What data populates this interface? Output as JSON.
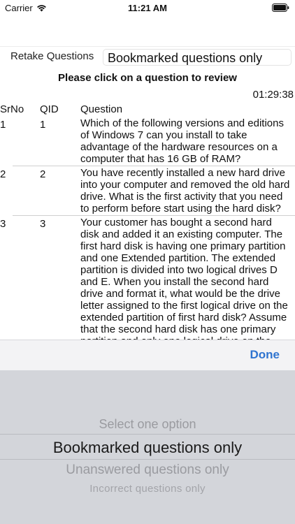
{
  "status_bar": {
    "carrier": "Carrier",
    "time": "11:21 AM"
  },
  "retake": {
    "label": "Retake Questions",
    "selected_filter": "Bookmarked questions only"
  },
  "instruction": "Please click on a question to review",
  "timer": "01:29:38",
  "table": {
    "headers": {
      "srno": "SrNo",
      "qid": "QID",
      "question": "Question"
    },
    "rows": [
      {
        "srno": "1",
        "qid": "1",
        "question": "Which of the following versions and editions of Windows 7 can you install to take advantage of the hardware resources on a computer that has 16 GB of  RAM?"
      },
      {
        "srno": "2",
        "qid": "2",
        "question": "You have recently installed a new hard drive into your computer and removed the old hard drive. What is the first activity that you need to perform before start using the hard disk?"
      },
      {
        "srno": "3",
        "qid": "3",
        "question": "Your customer has bought a second hard disk and added it an existing computer. The first hard disk is having one primary partition and one Extended partition. The extended partition is divided into two logical drives D and E. When you install the second hard drive and format it, what would be the drive letter assigned to the first logical drive on the extended partition of first hard disk? Assume that the second hard disk has one primary partition and only one logical drive on the"
      }
    ]
  },
  "picker": {
    "done_label": "Done",
    "options": [
      "Select one option",
      "Bookmarked questions only",
      "Unanswered questions only",
      "Incorrect questions only"
    ]
  },
  "colors": {
    "accent": "#2f74d0",
    "picker_bg": "#d3d5da",
    "toolbar_bg": "#f3f3f5"
  }
}
